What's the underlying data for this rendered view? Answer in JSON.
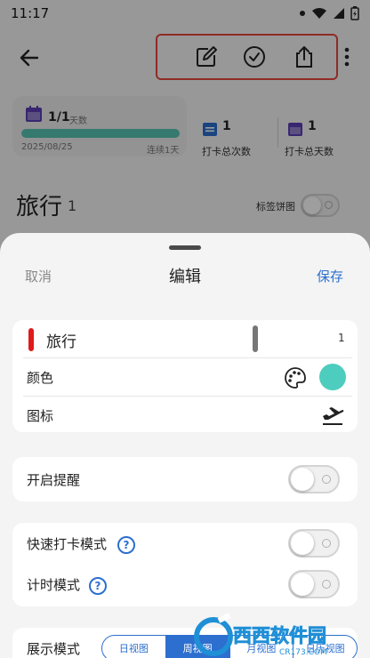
{
  "status_bar": {
    "time": "11:17"
  },
  "background": {
    "stats": {
      "fraction": "1/1",
      "fraction_unit": "天数",
      "progress": 1.0,
      "start_date": "2025/08/25",
      "streak": "连续1天",
      "checkin_count": "1",
      "checkin_count_label": "打卡总次数",
      "checkin_days": "1",
      "checkin_days_label": "打卡总天数"
    },
    "title": "旅行",
    "title_count": "1",
    "pie_toggle_label": "标签饼图"
  },
  "sheet": {
    "cancel": "取消",
    "title": "编辑",
    "save": "保存",
    "name_value": "旅行",
    "name_count": "1",
    "color_label": "颜色",
    "icon_label": "图标",
    "reminder_label": "开启提醒",
    "quick_mode_label": "快速打卡模式",
    "timer_mode_label": "计时模式",
    "display_mode_label": "展示模式",
    "display_modes": [
      "日视图",
      "周视图",
      "月视图",
      "日历视图"
    ],
    "display_mode_selected": "周视图"
  },
  "colors": {
    "accent": "#2c6fcf",
    "tag_marker": "#e01b1b",
    "selected_color": "#4dcdbd",
    "highlight_box": "#e8463a",
    "progress": "#57c4b4"
  },
  "watermark": {
    "text": "西西软件园",
    "sub": "CR173.COM"
  }
}
